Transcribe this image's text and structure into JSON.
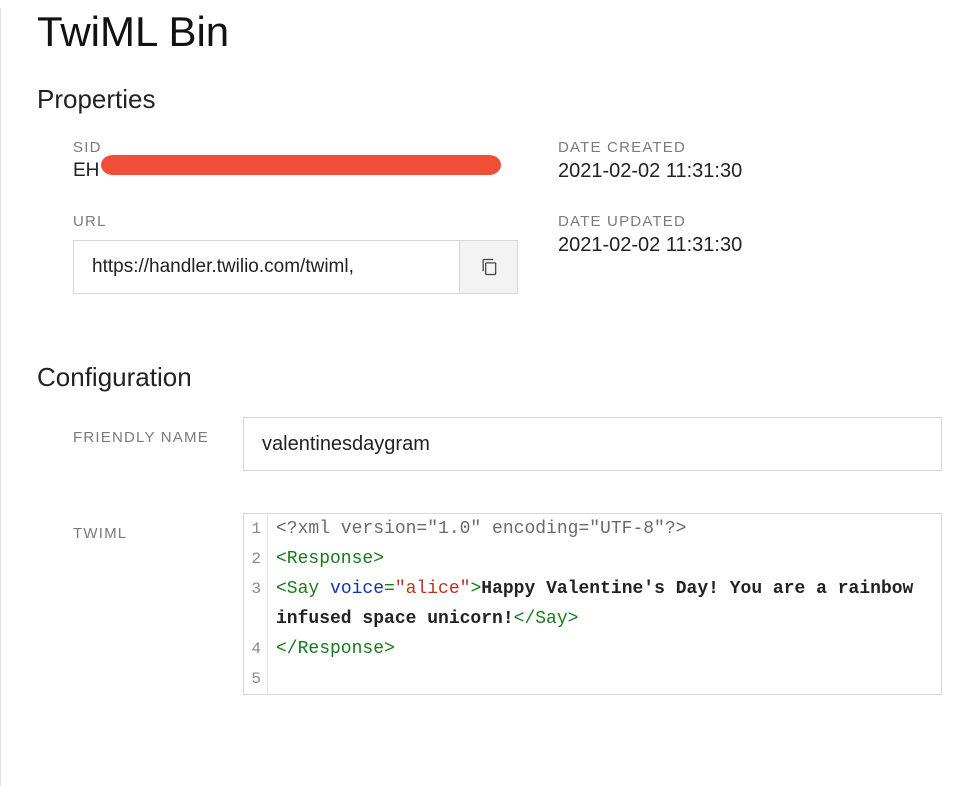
{
  "page": {
    "title": "TwiML Bin"
  },
  "properties": {
    "section_title": "Properties",
    "sid": {
      "label": "SID",
      "value": "EH"
    },
    "url": {
      "label": "URL",
      "value": "https://handler.twilio.com/twiml,"
    },
    "date_created": {
      "label": "DATE CREATED",
      "value": "2021-02-02 11:31:30"
    },
    "date_updated": {
      "label": "DATE UPDATED",
      "value": "2021-02-02 11:31:30"
    }
  },
  "configuration": {
    "section_title": "Configuration",
    "friendly_name": {
      "label": "FRIENDLY NAME",
      "value": "valentinesdaygram"
    },
    "twiml": {
      "label": "TWIML",
      "line1": "<?xml version=\"1.0\" encoding=\"UTF-8\"?>",
      "line2_open": "<Response>",
      "line3_open": "<Say ",
      "line3_attr": "voice",
      "line3_eq": "=",
      "line3_val": "\"alice\"",
      "line3_gt": ">",
      "line3_text": "Happy Valentine's Day! You are a rainbow infused space unicorn!",
      "line3_close": "</Say>",
      "line4_close": "</Response>",
      "ln1": "1",
      "ln2": "2",
      "ln3": "3",
      "ln4": "4",
      "ln5": "5"
    }
  }
}
